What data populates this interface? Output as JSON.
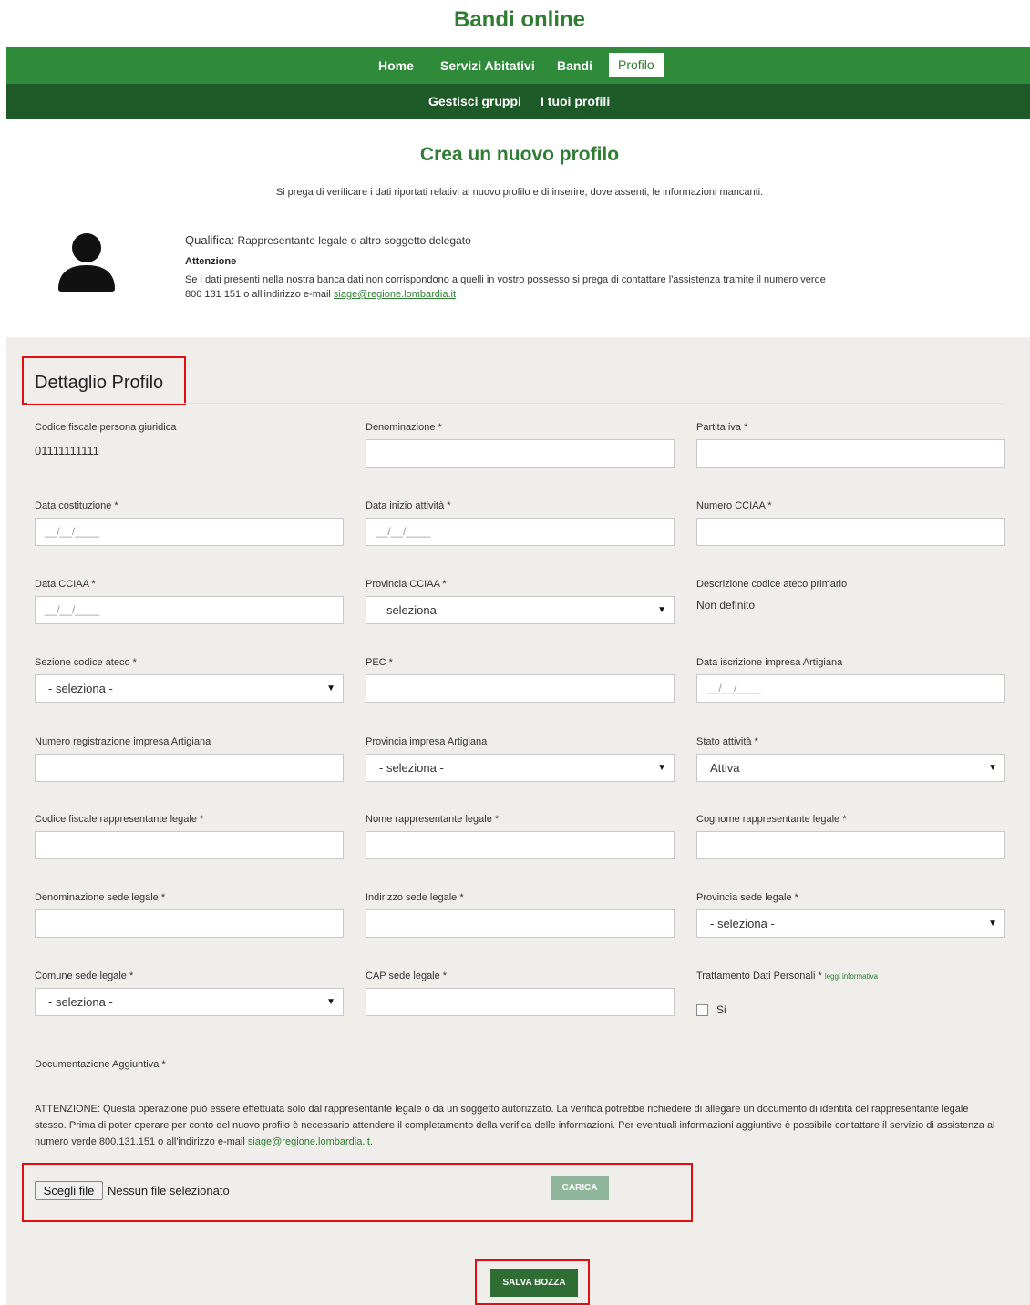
{
  "site": {
    "title": "Bandi online"
  },
  "nav": {
    "primary": [
      "Home",
      "Servizi Abitativi",
      "Bandi",
      "Profilo"
    ],
    "secondary": [
      "Gestisci gruppi",
      "I tuoi profili"
    ]
  },
  "page": {
    "title": "Crea un nuovo profilo",
    "intro": "Si prega di verificare i dati riportati relativi al nuovo profilo e di inserire, dove assenti, le informazioni mancanti."
  },
  "profile_info": {
    "qualifica_label": "Qualifica:",
    "qualifica_value": "Rappresentante legale o altro soggetto delegato",
    "attention_title": "Attenzione",
    "attention_text": "Se i dati presenti nella nostra banca dati non corrispondono a quelli in vostro possesso si prega di contattare l'assistenza tramite il numero verde 800 131 151 o all'indirizzo e-mail ",
    "attention_email": "siage@regione.lombardia.it"
  },
  "section": {
    "title": "Dettaglio Profilo"
  },
  "fields": {
    "codice_fiscale_pg": {
      "label": "Codice fiscale persona giuridica",
      "value": "01111111111"
    },
    "denominazione": {
      "label": "Denominazione *"
    },
    "partita_iva": {
      "label": "Partita iva *"
    },
    "data_costituzione": {
      "label": "Data costituzione *",
      "placeholder": "__/__/____"
    },
    "data_inizio_attivita": {
      "label": "Data inizio attività *",
      "placeholder": "__/__/____"
    },
    "numero_cciaa": {
      "label": "Numero CCIAA *"
    },
    "data_cciaa": {
      "label": "Data CCIAA *",
      "placeholder": "__/__/____"
    },
    "provincia_cciaa": {
      "label": "Provincia CCIAA *",
      "selected": "- seleziona -"
    },
    "descrizione_ateco": {
      "label": "Descrizione codice ateco primario",
      "value": "Non definito"
    },
    "sezione_ateco": {
      "label": "Sezione codice ateco *",
      "selected": "- seleziona -"
    },
    "pec": {
      "label": "PEC *"
    },
    "data_iscrizione_artigiana": {
      "label": "Data iscrizione impresa Artigiana",
      "placeholder": "__/__/____"
    },
    "numero_reg_artigiana": {
      "label": "Numero registrazione impresa Artigiana"
    },
    "provincia_artigiana": {
      "label": "Provincia impresa Artigiana",
      "selected": "- seleziona -"
    },
    "stato_attivita": {
      "label": "Stato attività *",
      "selected": "Attiva"
    },
    "cf_rappresentante": {
      "label": "Codice fiscale rappresentante legale *"
    },
    "nome_rappresentante": {
      "label": "Nome rappresentante legale *"
    },
    "cognome_rappresentante": {
      "label": "Cognome rappresentante legale *"
    },
    "denominazione_sede": {
      "label": "Denominazione sede legale *"
    },
    "indirizzo_sede": {
      "label": "Indirizzo sede legale *"
    },
    "provincia_sede": {
      "label": "Provincia sede legale *",
      "selected": "- seleziona -"
    },
    "comune_sede": {
      "label": "Comune sede legale *",
      "selected": "- seleziona -"
    },
    "cap_sede": {
      "label": "CAP sede legale *"
    },
    "trattamento_dati": {
      "label": "Trattamento Dati Personali *",
      "link": "leggi informativa",
      "checkbox_label": "Si",
      "checked": false
    }
  },
  "documentation": {
    "label": "Documentazione Aggiuntiva *",
    "notice": "ATTENZIONE: Questa operazione può essere effettuata solo dal rappresentante legale o da un soggetto autorizzato. La verifica potrebbe richiedere di allegare un documento di identità del rappresentante legale stesso. Prima di poter operare per conto del nuovo profilo è necessario attendere il completamento della verifica delle informazioni. Per eventuali informazioni aggiuntive è possibile contattare il servizio di assistenza al numero verde 800.131.151 o all'indirizzo e-mail ",
    "notice_email": "siage@regione.lombardia.it",
    "notice_end": ".",
    "choose_file": "Scegli file",
    "no_file": "Nessun file selezionato",
    "upload": "CARICA"
  },
  "actions": {
    "save_draft": "SALVA BOZZA"
  },
  "colors": {
    "brand": "#2e7d32",
    "nav_top": "#2f8a3a",
    "nav_bottom": "#1d5a27",
    "highlight": "#e01010",
    "panel_bg": "#efeeea"
  }
}
